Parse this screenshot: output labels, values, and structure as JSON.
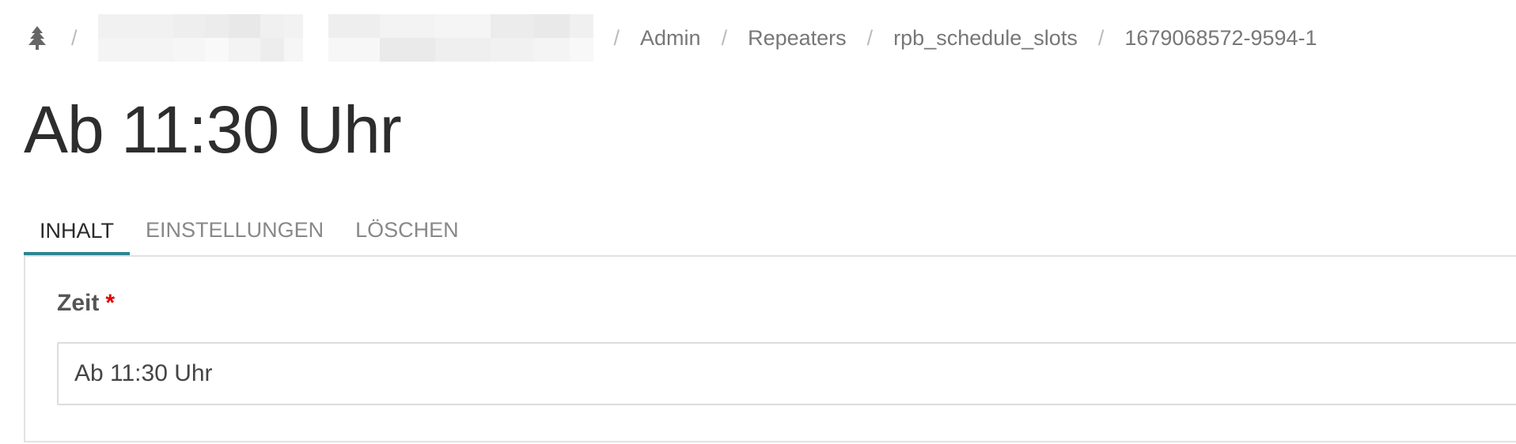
{
  "breadcrumb": {
    "home_icon": "tree-icon",
    "separator": "/",
    "items": [
      "Admin",
      "Repeaters",
      "rpb_schedule_slots",
      "1679068572-9594-1"
    ]
  },
  "page": {
    "title": "Ab 11:30 Uhr"
  },
  "tabs": [
    "INHALT",
    "EINSTELLUNGEN",
    "LÖSCHEN"
  ],
  "form": {
    "field_label": "Zeit",
    "required_mark": "*",
    "field_value": "Ab 11:30 Uhr"
  },
  "colors": {
    "accent": "#2e8493",
    "required": "#e00000"
  }
}
